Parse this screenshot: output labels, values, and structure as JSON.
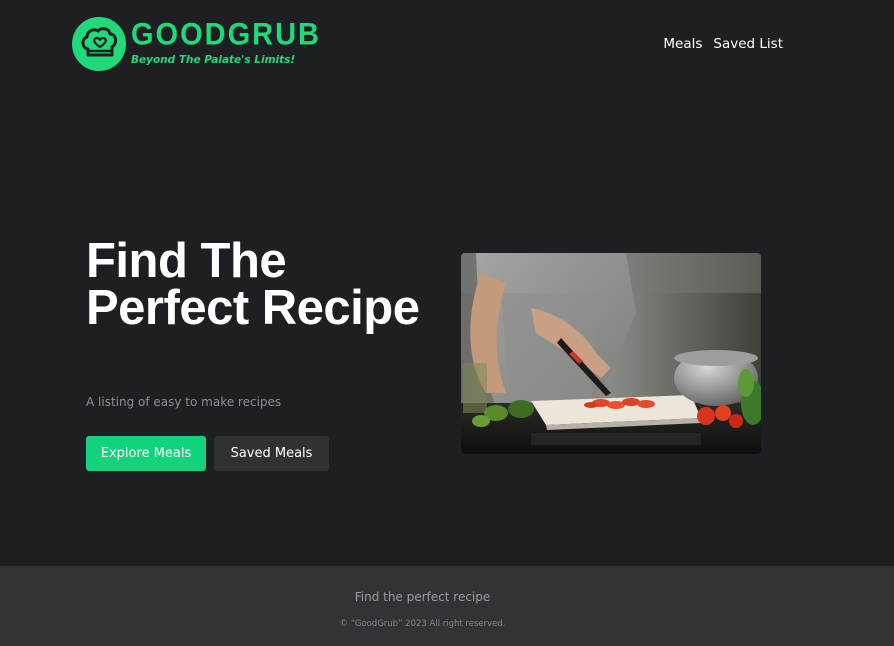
{
  "brand": {
    "name": "GOODGRUB",
    "tagline": "Beyond The Palate's Limits!",
    "accent_color": "#1fd97a",
    "logo_icon": "chef-hat-heart-icon"
  },
  "nav": {
    "items": [
      {
        "label": "Meals"
      },
      {
        "label": "Saved List"
      }
    ]
  },
  "hero": {
    "title": "Find The Perfect Recipe",
    "subtitle": "A listing of easy to make recipes",
    "primary_button": "Explore Meals",
    "secondary_button": "Saved Meals",
    "primary_color": "#12d37b",
    "image_subject": "person slicing tomatoes on a cutting board"
  },
  "footer": {
    "title": "Find the perfect recipe",
    "copyright": "© “GoodGrub” 2023 All right reserved."
  },
  "colors": {
    "background": "#1e1f22",
    "footer_background": "#323336"
  }
}
